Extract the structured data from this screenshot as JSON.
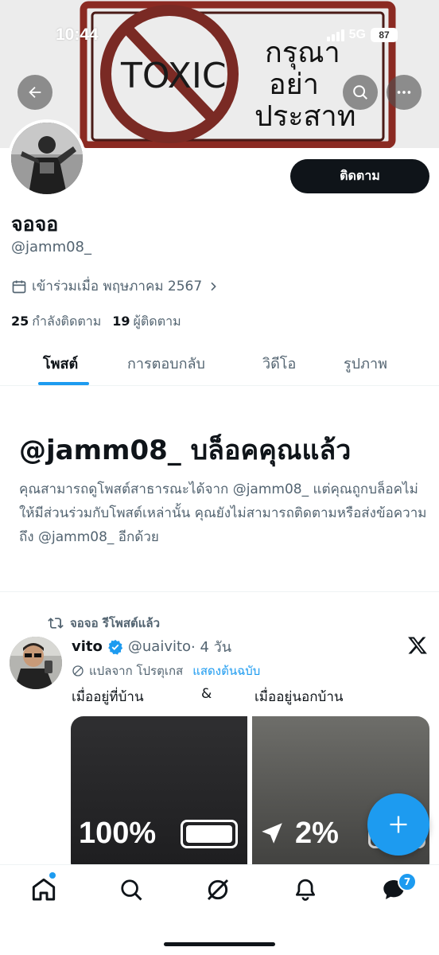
{
  "status_bar": {
    "time": "10:44",
    "network": "5G",
    "battery": "87"
  },
  "banner": {
    "sign_word": "TOXIC",
    "thai_text_lines": [
      "กรุณา",
      "อย่า",
      "ประสาท"
    ]
  },
  "profile": {
    "follow_label": "ติดตาม",
    "display_name": "จอจอ",
    "handle": "@jamm08_",
    "joined": "เข้าร่วมเมื่อ พฤษภาคม 2567",
    "following_count": "25",
    "following_label": "กำลังติดตาม",
    "followers_count": "19",
    "followers_label": "ผู้ติดตาม"
  },
  "tabs": [
    {
      "label": "โพสต์",
      "active": true
    },
    {
      "label": "การตอบกลับ",
      "active": false
    },
    {
      "label": "วิดีโอ",
      "active": false
    },
    {
      "label": "รูปภาพ",
      "active": false
    }
  ],
  "blocked": {
    "title": "@jamm08_ บล็อคคุณแล้ว",
    "description": "คุณสามารถดูโพสต์สาธารณะได้จาก @jamm08_ แต่คุณถูกบล็อคไม่ให้มีส่วนร่วมกับโพสต์เหล่านั้น คุณยังไม่สามารถติดตามหรือส่งข้อความถึง @jamm08_ อีกด้วย"
  },
  "post": {
    "repost_label": "จอจอ รีโพสต์แล้ว",
    "author_name": "vito",
    "author_handle": "@uaivito",
    "time_meta": "· 4 วัน",
    "translated_label": "แปลจาก โปรตุเกส",
    "show_original": "แสดงต้นฉบับ",
    "text_left": "เมื่ออยู่ที่บ้าน",
    "text_mid": "&",
    "text_right": "เมื่ออยู่นอกบ้าน",
    "media_left_text": "100%",
    "media_right_text": "2%"
  },
  "bottom_nav": {
    "messages_badge": "7"
  },
  "colors": {
    "accent": "#1d9bf0",
    "text": "#0f1419",
    "secondary": "#536471",
    "follow_button": "#0f1419"
  },
  "icons": [
    "back-arrow-icon",
    "search-icon",
    "more-icon",
    "calendar-icon",
    "chevron-right-icon",
    "repost-icon",
    "verified-icon",
    "x-logo-icon",
    "translate-icon",
    "compose-icon",
    "home-icon",
    "explore-icon",
    "grok-icon",
    "bell-icon",
    "messages-icon"
  ]
}
